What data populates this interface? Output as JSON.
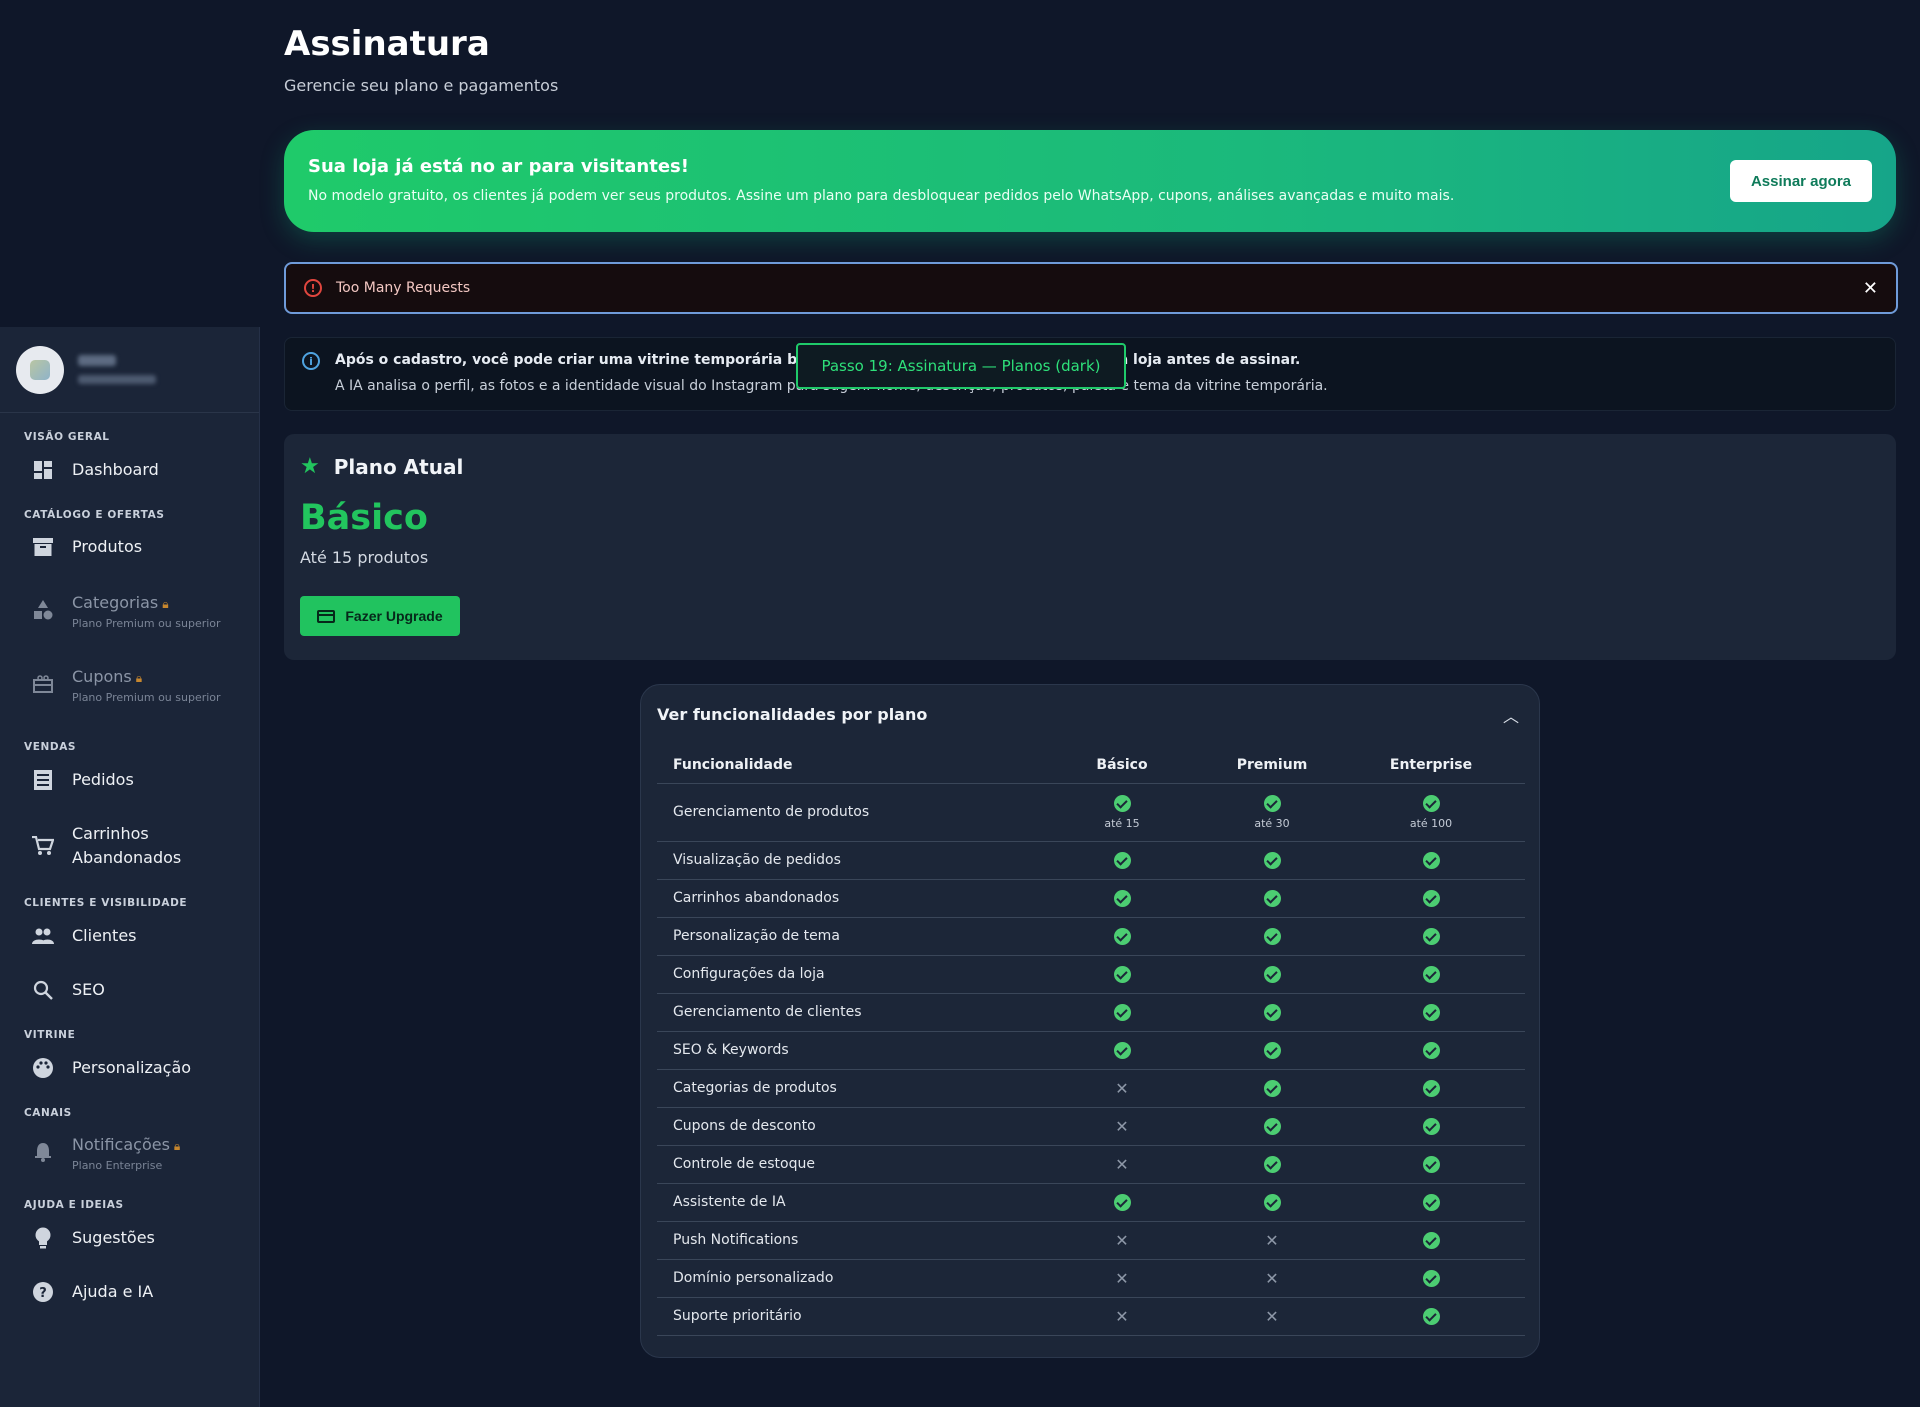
{
  "page": {
    "title": "Assinatura",
    "subtitle": "Gerencie seu plano e pagamentos"
  },
  "banner": {
    "title": "Sua loja já está no ar para visitantes!",
    "text": "No modelo gratuito, os clientes já podem ver seus produtos. Assine um plano para desbloquear pedidos pelo WhatsApp, cupons, análises avançadas e muito mais.",
    "button": "Assinar agora"
  },
  "error": {
    "text": "Too Many Requests",
    "close": "✕"
  },
  "info": {
    "line1": "Após o cadastro, você pode criar uma vitrine temporária baseada no Instagram para apresentar sua loja antes de assinar.",
    "line2": "A IA analisa o perfil, as fotos e a identidade visual do Instagram para sugerir nome, descrição, produtos, paleta e tema da vitrine temporária."
  },
  "tooltip": "Passo 19: Assinatura — Planos (dark)",
  "plan": {
    "header": "Plano Atual",
    "name": "Básico",
    "desc": "Até 15 produtos",
    "upgrade": "Fazer Upgrade"
  },
  "sidebar": {
    "sections": {
      "overview": "Visão geral",
      "catalog": "Catálogo e ofertas",
      "sales": "Vendas",
      "customers": "Clientes e visibilidade",
      "storefront": "Vitrine",
      "channels": "Canais",
      "help": "Ajuda e ideias"
    },
    "items": {
      "dashboard": "Dashboard",
      "products": "Produtos",
      "categories": "Categorias",
      "categories_sub": "Plano Premium ou superior",
      "coupons": "Cupons",
      "coupons_sub": "Plano Premium ou superior",
      "orders": "Pedidos",
      "carts_1": "Carrinhos",
      "carts_2": "Abandonados",
      "clients": "Clientes",
      "seo": "SEO",
      "personalization": "Personalização",
      "notifications": "Notificações",
      "notifications_sub": "Plano Enterprise",
      "suggestions": "Sugestões",
      "help": "Ajuda e IA"
    }
  },
  "features": {
    "title": "Ver funcionalidades por plano",
    "columns": [
      "Funcionalidade",
      "Básico",
      "Premium",
      "Enterprise"
    ],
    "limits": [
      "até 15",
      "até 30",
      "até 100"
    ],
    "rows": [
      "Gerenciamento de produtos",
      "Visualização de pedidos",
      "Carrinhos abandonados",
      "Personalização de tema",
      "Configurações da loja",
      "Gerenciamento de clientes",
      "SEO & Keywords",
      "Categorias de produtos",
      "Cupons de desconto",
      "Controle de estoque",
      "Assistente de IA",
      "Push Notifications",
      "Domínio personalizado",
      "Suporte prioritário"
    ]
  },
  "colors": {
    "accent": "#22c55e",
    "background": "#0f1729",
    "sidebar": "#1b2538",
    "error": "#e0463e"
  }
}
